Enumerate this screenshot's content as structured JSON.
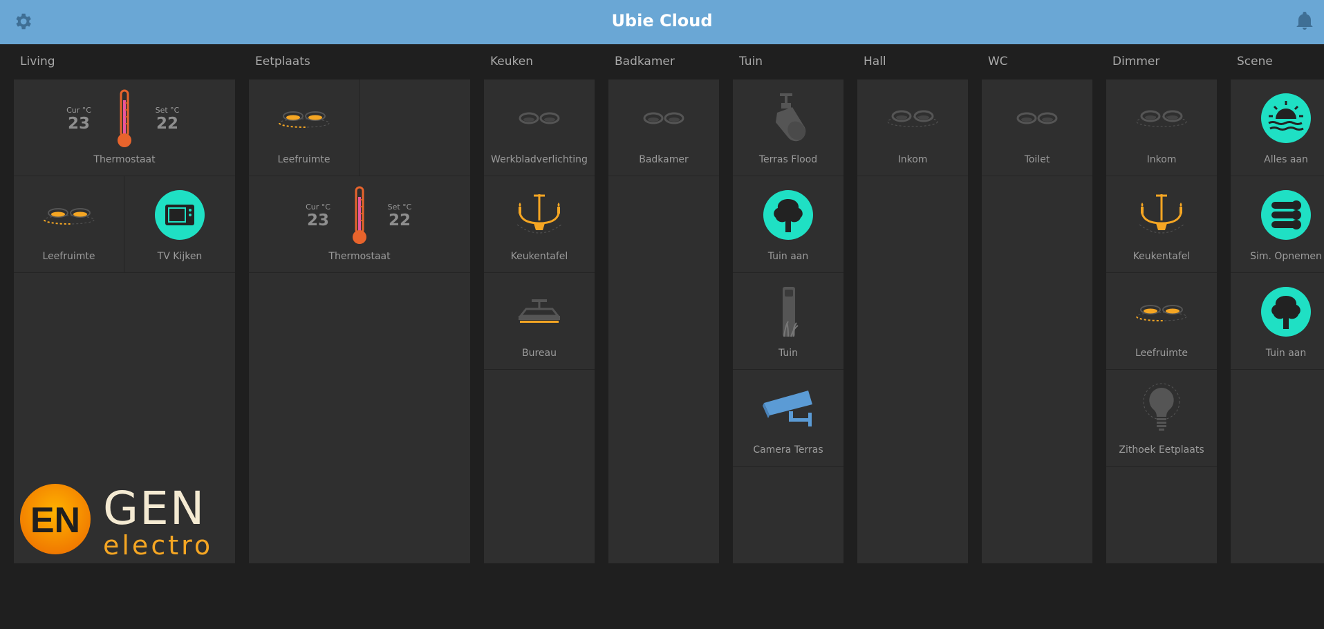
{
  "app": {
    "title": "Ubie Cloud"
  },
  "header": {
    "settings_icon": "gear-icon",
    "notifications_icon": "bell-icon"
  },
  "columns": {
    "living": {
      "title": "Living",
      "thermostat": {
        "cur_label": "Cur °C",
        "cur_value": "23",
        "set_label": "Set °C",
        "set_value": "22",
        "label": "Thermostaat"
      },
      "tiles": [
        {
          "label": "Leefruimte",
          "icon": "ceiling-spots-on-icon"
        },
        {
          "label": "TV Kijken",
          "icon": "tv-scene-icon"
        }
      ],
      "logo": {
        "line1": "GEN",
        "line2": "electro",
        "mark": "EN"
      }
    },
    "eetplaats": {
      "title": "Eetplaats",
      "tiles": [
        {
          "label": "Leefruimte",
          "icon": "ceiling-spots-on-icon"
        }
      ],
      "thermostat": {
        "cur_label": "Cur °C",
        "cur_value": "23",
        "set_label": "Set °C",
        "set_value": "22",
        "label": "Thermostaat"
      }
    },
    "keuken": {
      "title": "Keuken",
      "tiles": [
        {
          "label": "Werkbladverlichting",
          "icon": "ceiling-spots-off-icon"
        },
        {
          "label": "Keukentafel",
          "icon": "chandelier-icon"
        },
        {
          "label": "Bureau",
          "icon": "pendant-lamp-icon"
        }
      ]
    },
    "badkamer": {
      "title": "Badkamer",
      "tiles": [
        {
          "label": "Badkamer",
          "icon": "ceiling-spots-off-icon"
        }
      ]
    },
    "tuin": {
      "title": "Tuin",
      "tiles": [
        {
          "label": "Terras Flood",
          "icon": "floodlight-icon"
        },
        {
          "label": "Tuin aan",
          "icon": "tree-scene-icon"
        },
        {
          "label": "Tuin",
          "icon": "garden-post-light-icon"
        },
        {
          "label": "Camera Terras",
          "icon": "security-camera-icon"
        }
      ]
    },
    "hall": {
      "title": "Hall",
      "tiles": [
        {
          "label": "Inkom",
          "icon": "ceiling-spots-off-icon"
        }
      ]
    },
    "wc": {
      "title": "WC",
      "tiles": [
        {
          "label": "Toilet",
          "icon": "ceiling-spots-off-icon"
        }
      ]
    },
    "dimmer": {
      "title": "Dimmer",
      "tiles": [
        {
          "label": "Inkom",
          "icon": "ceiling-spots-off-icon"
        },
        {
          "label": "Keukentafel",
          "icon": "chandelier-icon"
        },
        {
          "label": "Leefruimte",
          "icon": "ceiling-spots-on-icon"
        },
        {
          "label": "Zithoek Eetplaats",
          "icon": "light-bulb-icon"
        }
      ]
    },
    "scene": {
      "title": "Scene",
      "tiles": [
        {
          "label": "Alles aan",
          "icon": "sunrise-scene-icon"
        },
        {
          "label": "Sim. Opnemen",
          "icon": "record-scene-icon"
        },
        {
          "label": "Tuin aan",
          "icon": "tree-scene-icon"
        }
      ]
    }
  },
  "colors": {
    "header": "#6aa7d5",
    "background": "#1f1f1f",
    "panel": "#2f2f2f",
    "accent_on": "#f5a623",
    "scene_teal": "#1fe0c4",
    "thermometer": "#e8642c",
    "camera": "#5b9bd5"
  }
}
